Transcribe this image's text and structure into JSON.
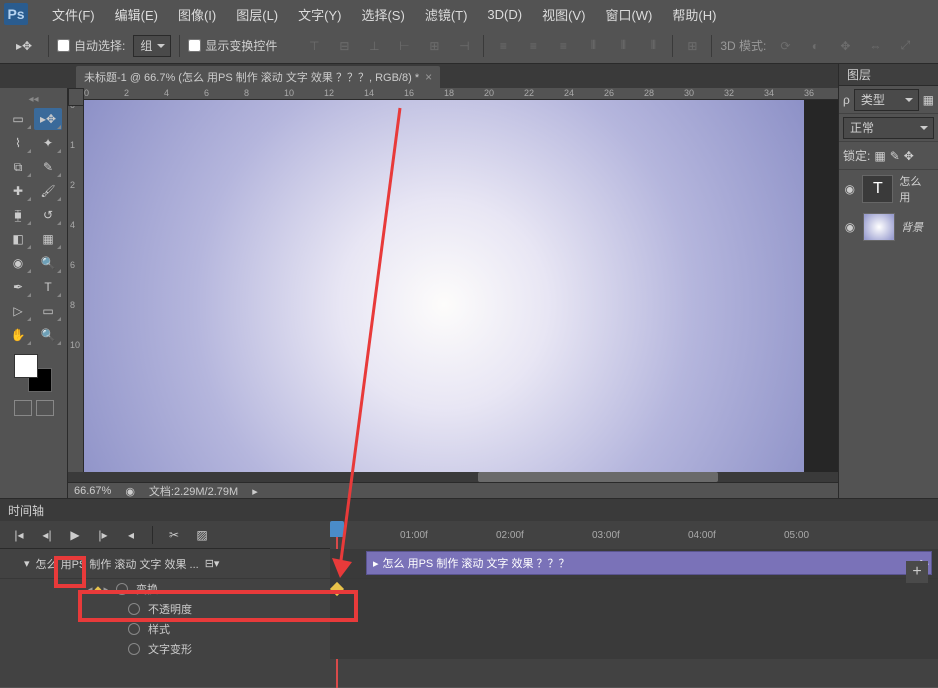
{
  "menubar": {
    "items": [
      "文件(F)",
      "编辑(E)",
      "图像(I)",
      "图层(L)",
      "文字(Y)",
      "选择(S)",
      "滤镜(T)",
      "3D(D)",
      "视图(V)",
      "窗口(W)",
      "帮助(H)"
    ]
  },
  "optionsbar": {
    "auto_select_label": "自动选择:",
    "group_mode": "组",
    "show_transform_label": "显示变换控件",
    "mode_3d_label": "3D 模式:"
  },
  "document": {
    "tab_title": "未标题-1 @ 66.7% (怎么 用PS 制作 滚动 文字 效果 ？？？, RGB/8) *"
  },
  "ruler_h": [
    "0",
    "2",
    "4",
    "6",
    "8",
    "10",
    "12",
    "14",
    "16",
    "18",
    "20",
    "22",
    "24",
    "26",
    "28",
    "30",
    "32",
    "34",
    "36"
  ],
  "ruler_v": [
    "0",
    "1",
    "2",
    "4",
    "6",
    "8",
    "10"
  ],
  "status": {
    "zoom": "66.67%",
    "doc_info": "文档:2.29M/2.79M"
  },
  "layers_panel": {
    "title": "图层",
    "filter_label": "类型",
    "blend_mode": "正常",
    "lock_label": "锁定:",
    "layers": [
      {
        "name": "怎么 用",
        "type": "text"
      },
      {
        "name": "背景",
        "type": "bg"
      }
    ]
  },
  "timeline": {
    "tab": "时间轴",
    "time_marks": [
      "01:00f",
      "02:00f",
      "03:00f",
      "04:00f",
      "05:00"
    ],
    "track_name": "怎么 用PS 制作 滚动 文字 效果 ...",
    "clip_name": "怎么 用PS 制作 滚动 文字 效果 ？？？",
    "props": [
      "变换",
      "不透明度",
      "样式",
      "文字变形"
    ]
  }
}
